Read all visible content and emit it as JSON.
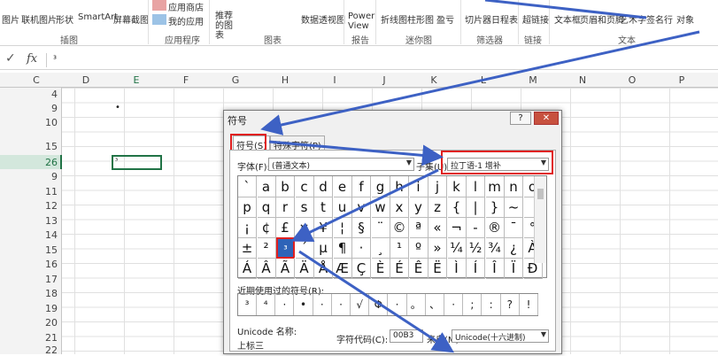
{
  "ribbon": {
    "items": [
      {
        "label": "图片"
      },
      {
        "label": "联机图片"
      },
      {
        "label": "形状"
      },
      {
        "label": "SmartArt"
      },
      {
        "label": "屏幕截图"
      },
      {
        "label": "应用商店"
      },
      {
        "label": "我的应用"
      },
      {
        "label": "推荐的图表"
      },
      {
        "label": "数据透视图"
      },
      {
        "label": "Power View"
      },
      {
        "label": "折线图"
      },
      {
        "label": "柱形图"
      },
      {
        "label": "盈亏"
      },
      {
        "label": "切片器"
      },
      {
        "label": "日程表"
      },
      {
        "label": "超链接"
      },
      {
        "label": "文本框"
      },
      {
        "label": "页眉和页脚"
      },
      {
        "label": "艺术字"
      },
      {
        "label": "签名行"
      },
      {
        "label": "对象"
      }
    ],
    "groups": [
      "插图",
      "应用程序",
      "图表",
      "报告",
      "迷你图",
      "筛选器",
      "链接",
      "文本"
    ]
  },
  "formula_bar": {
    "check": "✓",
    "fx": "fx",
    "value": "³"
  },
  "columns": [
    "C",
    "D",
    "E",
    "F",
    "G",
    "H",
    "I",
    "J",
    "K",
    "L",
    "M",
    "N",
    "O",
    "P"
  ],
  "rows": [
    "4",
    "9",
    "10",
    "15",
    "26",
    "9",
    "11",
    "12",
    "13",
    "14",
    "15",
    "16",
    "17",
    "18",
    "19",
    "20",
    "21",
    "22"
  ],
  "cells": {
    "e9": "•",
    "e26": "³"
  },
  "dialog": {
    "title": "符号",
    "help": "?",
    "close": "✕",
    "tabs": [
      "符号(S)",
      "特殊字符(P)"
    ],
    "font_label": "字体(F):",
    "font_value": "(普通文本)",
    "subset_label": "子集(U):",
    "subset_value": "拉丁语-1 增补",
    "symbols": [
      [
        "`",
        "a",
        "b",
        "c",
        "d",
        "e",
        "f",
        "g",
        "h",
        "i",
        "j",
        "k",
        "l",
        "m",
        "n",
        "o"
      ],
      [
        "p",
        "q",
        "r",
        "s",
        "t",
        "u",
        "v",
        "w",
        "x",
        "y",
        "z",
        "{",
        "|",
        "}",
        "~",
        ""
      ],
      [
        "¡",
        "¢",
        "£",
        "¤",
        "¥",
        "¦",
        "§",
        "¨",
        "©",
        "ª",
        "«",
        "¬",
        "-",
        "®",
        "¯",
        "°"
      ],
      [
        "±",
        "²",
        "³",
        "´",
        "µ",
        "¶",
        "·",
        "¸",
        "¹",
        "º",
        "»",
        "¼",
        "½",
        "¾",
        "¿",
        "À"
      ],
      [
        "Á",
        "Â",
        "Ã",
        "Ä",
        "Å",
        "Æ",
        "Ç",
        "È",
        "É",
        "Ê",
        "Ë",
        "Ì",
        "Í",
        "Î",
        "Ï",
        "Ð"
      ]
    ],
    "recent_label": "近期使用过的符号(R):",
    "recent": [
      "³",
      "⁴",
      "·",
      "•",
      "·",
      "·",
      "√",
      "Φ",
      "·",
      "。",
      "、",
      "·",
      ";",
      ":",
      "?",
      "!"
    ],
    "unicode_label": "Unicode 名称:",
    "unicode_name": "上标三",
    "charcode_label": "字符代码(C):",
    "charcode_value": "00B3",
    "from_label": "来自(M):",
    "from_value": "Unicode(十六进制)"
  },
  "colors": {
    "accent": "#217346",
    "arrow": "#3d61c4",
    "highlight_box": "#e02020",
    "selected_symbol": "#2e63b8"
  }
}
